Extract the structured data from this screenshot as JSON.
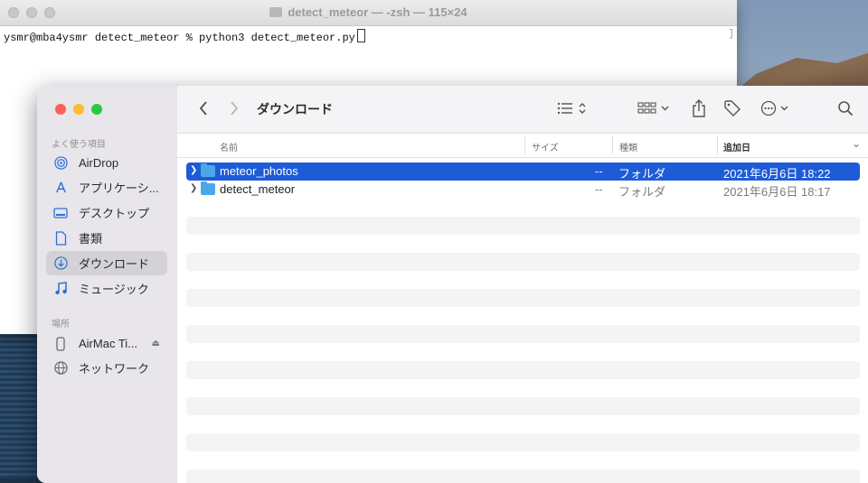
{
  "terminal": {
    "title": "detect_meteor — -zsh — 115×24",
    "prompt_line": "ysmr@mba4ysmr detect_meteor % python3 detect_meteor.py",
    "scroll_marker": "]"
  },
  "finder": {
    "toolbar": {
      "back_icon": "chevron-left-icon",
      "forward_icon": "chevron-right-icon",
      "title": "ダウンロード",
      "view_icon": "list-view-icon",
      "group_icon": "grid-group-icon",
      "share_icon": "share-icon",
      "tag_icon": "tag-icon",
      "more_icon": "ellipsis-icon",
      "search_icon": "search-icon"
    },
    "sidebar": {
      "favorites_header": "よく使う項目",
      "favorites": [
        {
          "label": "AirDrop",
          "icon": "airdrop-icon"
        },
        {
          "label": "アプリケーシ...",
          "icon": "applications-icon"
        },
        {
          "label": "デスクトップ",
          "icon": "desktop-icon"
        },
        {
          "label": "書類",
          "icon": "document-icon"
        },
        {
          "label": "ダウンロード",
          "icon": "download-icon",
          "selected": true
        },
        {
          "label": "ミュージック",
          "icon": "music-icon"
        }
      ],
      "locations_header": "場所",
      "locations": [
        {
          "label": "AirMac Ti...",
          "icon": "disk-icon",
          "eject": "⏏"
        },
        {
          "label": "ネットワーク",
          "icon": "network-icon"
        }
      ]
    },
    "columns": {
      "name": "名前",
      "size": "サイズ",
      "kind": "種類",
      "date_added": "追加日",
      "sort_indicator": "⌄"
    },
    "rows": [
      {
        "name": "meteor_photos",
        "size": "--",
        "kind": "フォルダ",
        "date": "2021年6月6日 18:22",
        "selected": true
      },
      {
        "name": "detect_meteor",
        "size": "--",
        "kind": "フォルダ",
        "date": "2021年6月6日 18:17",
        "selected": false
      }
    ]
  },
  "colors": {
    "selection": "#1d5bd7",
    "folder": "#4aa7e8",
    "close": "#fe5f57",
    "minimize": "#febc2e",
    "zoom": "#28c840"
  }
}
